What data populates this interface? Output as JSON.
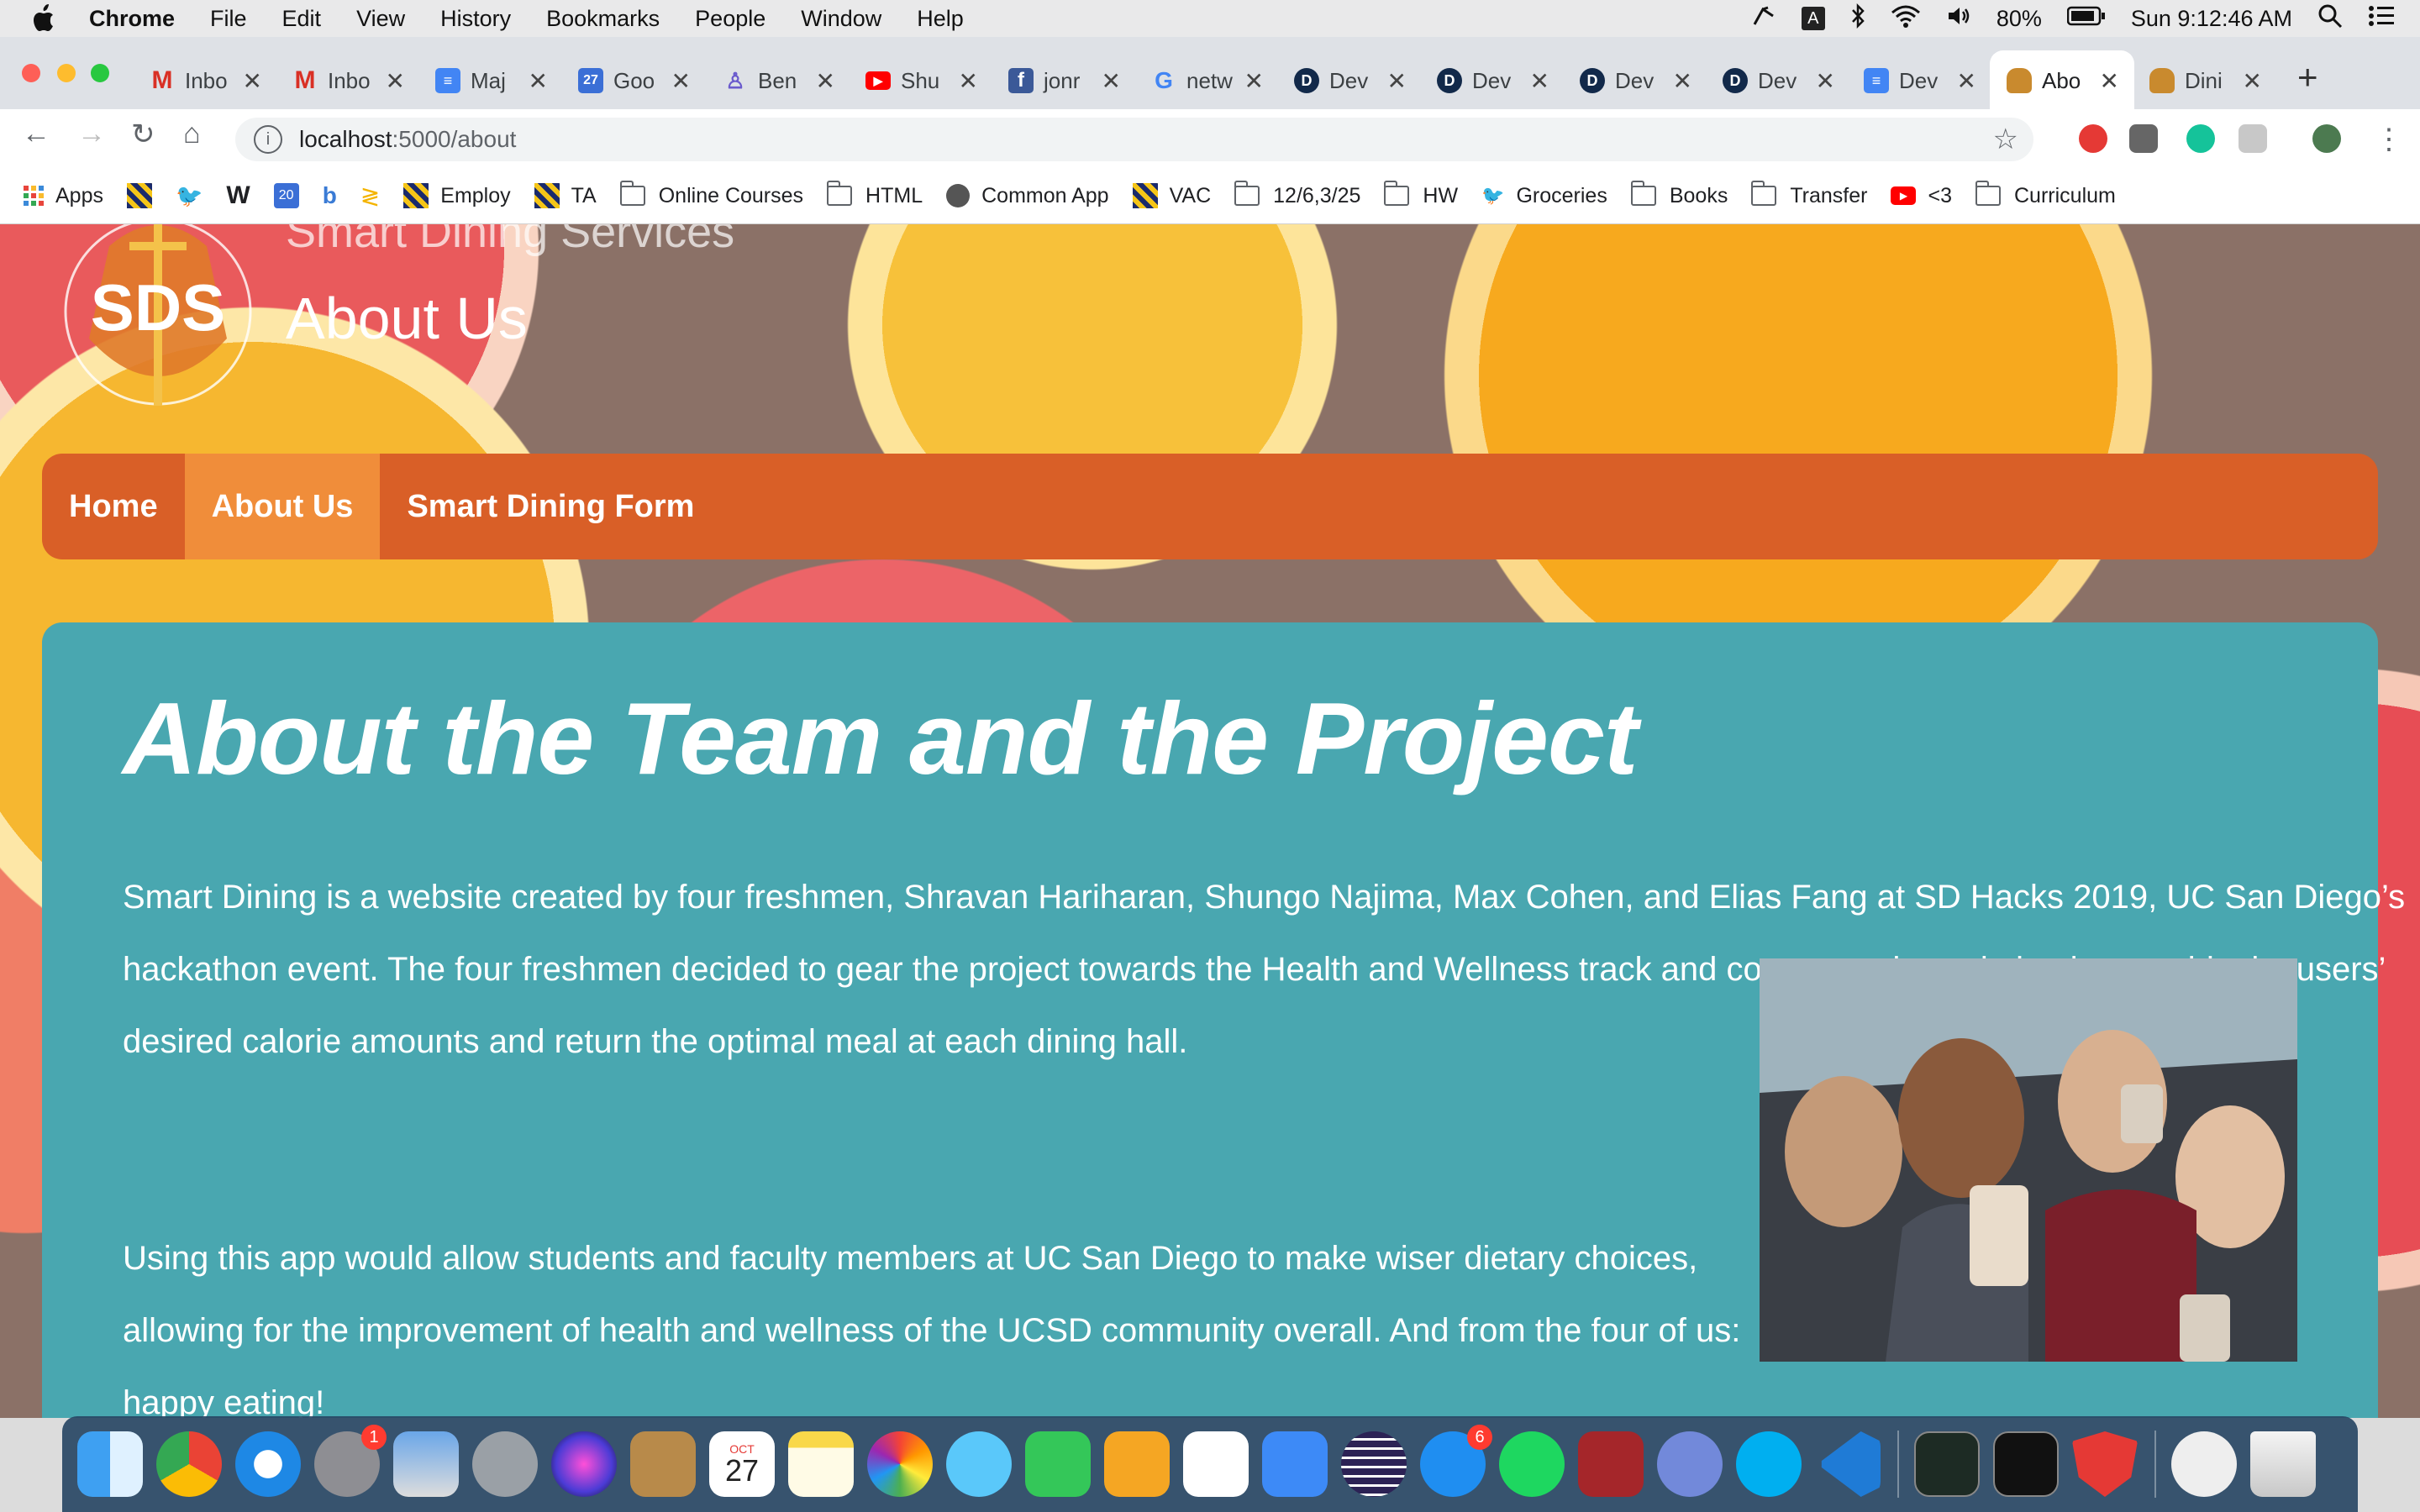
{
  "menubar": {
    "items": [
      "Chrome",
      "File",
      "Edit",
      "View",
      "History",
      "Bookmarks",
      "People",
      "Window",
      "Help"
    ],
    "battery": "80%",
    "clock": "Sun 9:12:46 AM",
    "input_indicator": "A"
  },
  "tabs": [
    {
      "label": "Inbo",
      "icon": "gmail-icon"
    },
    {
      "label": "Inbo",
      "icon": "gmail-icon"
    },
    {
      "label": "Maj",
      "icon": "docs-icon"
    },
    {
      "label": "Goo",
      "icon": "calendar-icon"
    },
    {
      "label": "Ben",
      "icon": "figure-icon"
    },
    {
      "label": "Shu",
      "icon": "youtube-icon"
    },
    {
      "label": "jonr",
      "icon": "facebook-icon"
    },
    {
      "label": "netw",
      "icon": "google-icon"
    },
    {
      "label": "Dev",
      "icon": "dev-icon"
    },
    {
      "label": "Dev",
      "icon": "dev-icon"
    },
    {
      "label": "Dev",
      "icon": "dev-icon"
    },
    {
      "label": "Dev",
      "icon": "dev-icon"
    },
    {
      "label": "Dev",
      "icon": "docs-icon"
    },
    {
      "label": "Abo",
      "icon": "burger-icon"
    },
    {
      "label": "Dini",
      "icon": "burger-icon"
    }
  ],
  "address": {
    "host": "localhost",
    "path": ":5000/about"
  },
  "bookmarks": {
    "apps": "Apps",
    "employ": "Employ",
    "ta": "TA",
    "online_courses": "Online Courses",
    "html": "HTML",
    "common_app": "Common App",
    "vac": "VAC",
    "dates": "12/6,3/25",
    "hw": "HW",
    "groceries": "Groceries",
    "books": "Books",
    "transfer": "Transfer",
    "heart": "<3",
    "curriculum": "Curriculum",
    "calendar_day": "20"
  },
  "site": {
    "title": "Smart Dining Services",
    "subtitle": "About Us",
    "logo_text": "SDS"
  },
  "nav": {
    "home": "Home",
    "about": "About Us",
    "form": "Smart Dining Form"
  },
  "content": {
    "heading": "About the Team and the Project",
    "paragraph1": "Smart Dining is a website created by four freshmen, Shravan Hariharan, Shungo Najima, Max Cohen, and Elias Fang at SD Hacks 2019, UC San Diego’s hackathon event. The four freshmen decided to gear the project towards the Health and Wellness track and constructed a website that would take users’ desired calorie amounts and return the optimal meal at each dining hall.",
    "paragraph2": "Using this app would allow students and faculty members at UC San Diego to make wiser dietary choices, allowing for the improvement of health and wellness of the UCSD community overall. And from the four of us: happy eating!"
  },
  "dock": {
    "calendar_month": "OCT",
    "calendar_day": "27",
    "prefs_badge": "1",
    "appstore_badge": "6"
  },
  "colors": {
    "nav_bg": "#d95f27",
    "nav_active": "#f08d3a",
    "panel_bg": "#49a7b0"
  }
}
